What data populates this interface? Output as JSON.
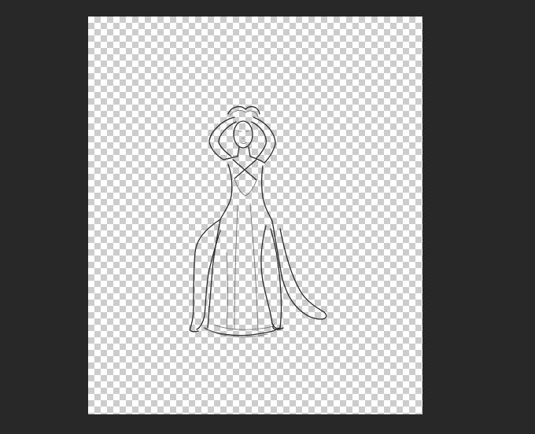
{
  "workspace": {
    "background_color": "#282828"
  },
  "document": {
    "background": "transparency-checkerboard",
    "checker_light": "#ffffff",
    "checker_dark": "#cccccc"
  },
  "layer": {
    "content": "pencil-sketch-figure",
    "stroke_color": "#2a2a2a"
  }
}
